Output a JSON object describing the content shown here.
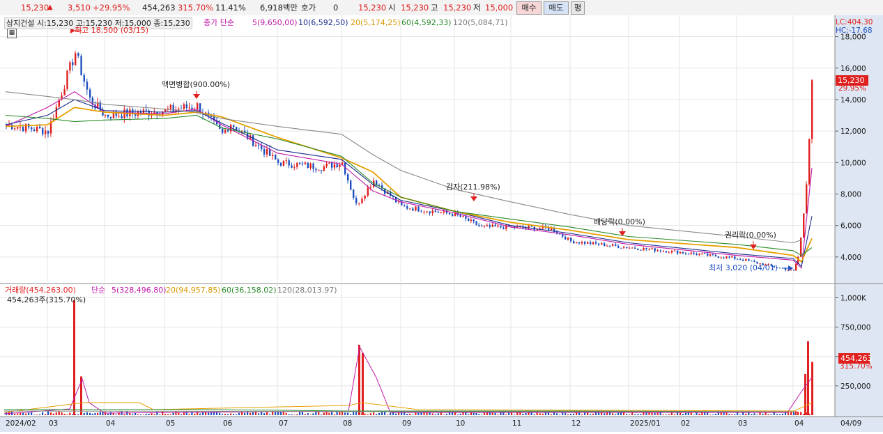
{
  "topbar": {
    "price": "15,230",
    "change": "3,510",
    "change_pct": "+29.95%",
    "volume": "454,263",
    "volume_ratio": "315.70%",
    "turnover": "11.41%",
    "amount": "6,918백만",
    "quote_label": "호가",
    "quote_value": "0",
    "quote_price": "15,230",
    "open_label": "시",
    "open_value": "15,230",
    "high_label": "고",
    "high_value": "15,230",
    "low_label": "저",
    "low_value": "15,000",
    "buy_label": "매수",
    "sell_label": "매도",
    "avg_label": "평"
  },
  "price_panel": {
    "title": "상지건설 시:15,230 고:15,230 저:15,000 종:15,230",
    "ma_label": "종가 단순",
    "ma5": "5(9,650,00)",
    "ma10": "10(6,592,50)",
    "ma20": "20(5,174,25)",
    "ma60": "60(4,592,33)",
    "ma120": "120(5,084,71)",
    "lc": "LC:404.30",
    "hc": "HC:-17.68",
    "current_price": "15,230",
    "current_pct": "29.95%"
  },
  "annotations": {
    "high": "최고 18,500 (03/15)",
    "split": "액면병합(900.00%)",
    "reduction": "감자(211.98%)",
    "dividend": "배당락(0.00%)",
    "rights": "권리락(0.00%)",
    "low": "최저 3,020 (04/01)"
  },
  "volume_panel": {
    "title": "거래량(454,263.00)",
    "ma_label": "단순",
    "ma5": "5(328,496.80)",
    "ma20": "20(94,957.85)",
    "ma60": "60(36,158.02)",
    "ma120": "120(28,013.97)",
    "sub": "454,263주(315.70%)",
    "current_volume": "454,263",
    "current_pct": "315.70%"
  },
  "x_axis": [
    "2024/02",
    "03",
    "04",
    "05",
    "06",
    "07",
    "08",
    "09",
    "10",
    "11",
    "12",
    "2025/01",
    "02",
    "03",
    "04",
    "04/09"
  ],
  "colors": {
    "up": "#e0201f",
    "down": "#1e4fbf",
    "ma5": "#c018a8",
    "ma10": "#1a2a8a",
    "ma20": "#e6a000",
    "ma60": "#2a8a2a",
    "ma120": "#888888"
  },
  "chart_data": [
    {
      "type": "candlestick",
      "title": "상지건설",
      "x_ticks": [
        "2024/02",
        "03",
        "04",
        "05",
        "06",
        "07",
        "08",
        "09",
        "10",
        "11",
        "12",
        "2025/01",
        "02",
        "03",
        "04"
      ],
      "y_ticks": [
        4000,
        6000,
        8000,
        10000,
        12000,
        14000,
        16000,
        18000
      ],
      "ylim": [
        2400,
        19000
      ],
      "close_series": [
        [
          "2024-02",
          12400
        ],
        [
          "2024-03-01",
          12000
        ],
        [
          "2024-03-15",
          17000
        ],
        [
          "2024-03-20",
          14000
        ],
        [
          "2024-04",
          13000
        ],
        [
          "2024-05",
          13300
        ],
        [
          "2024-05-20",
          13600
        ],
        [
          "2024-06",
          11800
        ],
        [
          "2024-06-20",
          12500
        ],
        [
          "2024-07",
          10000
        ],
        [
          "2024-07-25",
          9700
        ],
        [
          "2024-08",
          10000
        ],
        [
          "2024-08-10",
          7300
        ],
        [
          "2024-08-20",
          8900
        ],
        [
          "2024-09",
          7200
        ],
        [
          "2024-10",
          6700
        ],
        [
          "2024-10-15",
          5900
        ],
        [
          "2024-11",
          5900
        ],
        [
          "2024-11-25",
          5800
        ],
        [
          "2024-12",
          5000
        ],
        [
          "2025-01",
          4600
        ],
        [
          "2025-02",
          4300
        ],
        [
          "2025-03",
          3900
        ],
        [
          "2025-04-01",
          3100
        ],
        [
          "2025-04-02",
          4000
        ],
        [
          "2025-04-03",
          5200
        ],
        [
          "2025-04-04",
          6800
        ],
        [
          "2025-04-07",
          8800
        ],
        [
          "2025-04-08",
          11700
        ],
        [
          "2025-04-09",
          15230
        ]
      ],
      "ma_series": [
        {
          "name": "5",
          "values": [
            12300,
            13500,
            14500,
            13200,
            13100,
            13400,
            12400,
            10600,
            9900,
            8200,
            7500,
            6800,
            5900,
            5400,
            4800,
            4100,
            3800,
            3300,
            9650
          ]
        },
        {
          "name": "10",
          "values": [
            12400,
            13000,
            14000,
            13300,
            13200,
            13300,
            12500,
            10800,
            10200,
            8600,
            7600,
            6900,
            6000,
            5500,
            4900,
            4200,
            3900,
            3400,
            6592.5
          ]
        },
        {
          "name": "20",
          "values": [
            12300,
            12400,
            13500,
            13200,
            13000,
            13200,
            12900,
            11600,
            10300,
            9400,
            7800,
            6900,
            6200,
            5700,
            5100,
            4600,
            4100,
            3700,
            5174.25
          ]
        },
        {
          "name": "60",
          "values": [
            13000,
            12800,
            12600,
            12700,
            12800,
            13000,
            12200,
            11500,
            10400,
            8700,
            7800,
            6900,
            6400,
            5900,
            5300,
            4800,
            4400,
            4100,
            4592.33
          ]
        },
        {
          "name": "120",
          "values": [
            14500,
            14200,
            14000,
            13700,
            13400,
            13200,
            12800,
            12300,
            11800,
            10500,
            9500,
            8300,
            7500,
            6700,
            6000,
            5300,
            4900,
            5084.71
          ]
        }
      ]
    },
    {
      "type": "bar",
      "title": "거래량",
      "y_ticks": [
        250000,
        500000,
        750000,
        1000000
      ],
      "y_tick_labels": [
        "250,000",
        "500,000",
        "750,000",
        "1,000K"
      ],
      "ylim": [
        0,
        1080000
      ],
      "notable_values": [
        [
          "2024-03-15",
          980000
        ],
        [
          "2024-03-18",
          330000
        ],
        [
          "2024-08-09",
          600000
        ],
        [
          "2024-08-12",
          530000
        ],
        [
          "2025-04-07",
          350000
        ],
        [
          "2025-04-08",
          630000
        ],
        [
          "2025-04-09",
          454263
        ]
      ]
    }
  ]
}
